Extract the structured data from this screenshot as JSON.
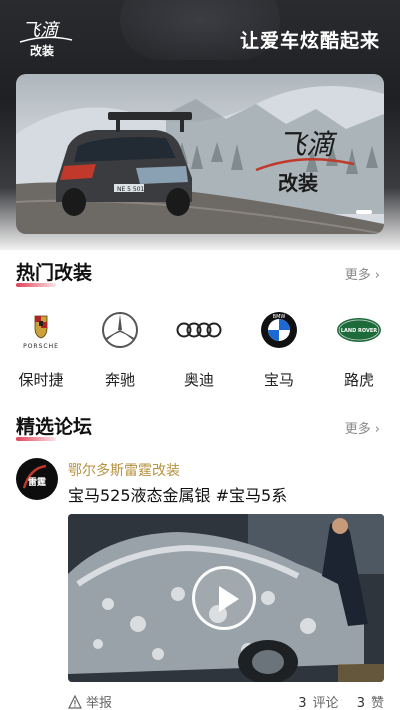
{
  "header": {
    "logo_text": "飞滴改装",
    "slogan": "让爱车炫酷起来"
  },
  "banner": {
    "logo_text": "飞滴改装",
    "car_plate": "NE 5 501"
  },
  "hot_mods": {
    "title": "热门改装",
    "more_label": "更多",
    "brands": [
      {
        "name": "保时捷",
        "icon": "porsche-logo-icon",
        "logo_text": "PORSCHE"
      },
      {
        "name": "奔驰",
        "icon": "mercedes-logo-icon"
      },
      {
        "name": "奥迪",
        "icon": "audi-logo-icon"
      },
      {
        "name": "宝马",
        "icon": "bmw-logo-icon",
        "logo_text": "BMW"
      },
      {
        "name": "路虎",
        "icon": "landrover-logo-icon",
        "logo_text": "LAND ROVER"
      }
    ]
  },
  "forum": {
    "title": "精选论坛",
    "more_label": "更多",
    "post": {
      "author": "鄂尔多斯雷霆改装",
      "title": "宝马525液态金属银 #宝马5系",
      "report_label": "举报",
      "comments_count": "3",
      "comments_label": "评论",
      "likes_count": "3",
      "likes_label": "赞"
    }
  },
  "colors": {
    "accent": "#e0425a",
    "author": "#b7923f"
  }
}
